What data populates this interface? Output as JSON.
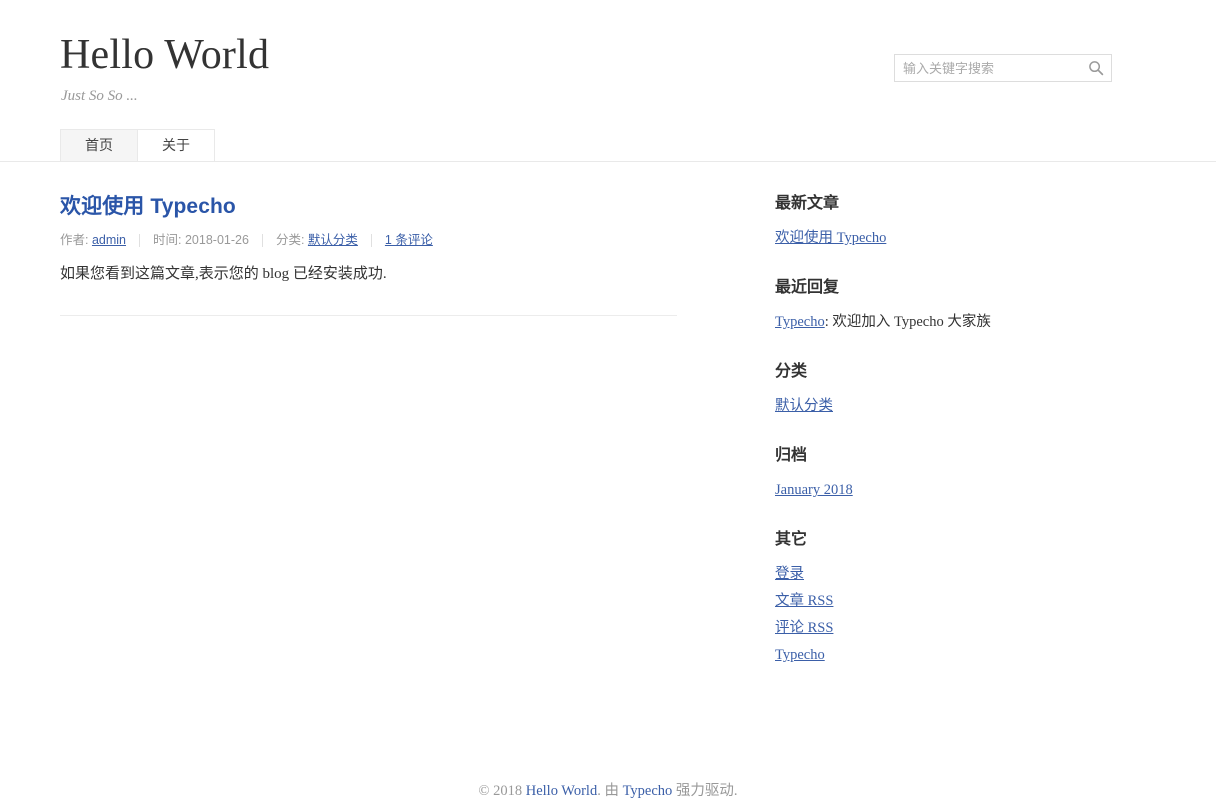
{
  "header": {
    "title": "Hello World",
    "description": "Just So So ...",
    "nav": [
      {
        "label": "首页",
        "active": true
      },
      {
        "label": "关于",
        "active": false
      }
    ],
    "search": {
      "placeholder": "输入关键字搜索",
      "value": "",
      "icon": "search-icon"
    }
  },
  "main": {
    "post": {
      "title": "欢迎使用 Typecho",
      "meta": {
        "author_label": "作者:",
        "author": "admin",
        "date_label": "时间:",
        "date": "2018-01-26",
        "category_label": "分类:",
        "category": "默认分类",
        "comments": "1 条评论"
      },
      "content": "如果您看到这篇文章,表示您的 blog 已经安装成功."
    }
  },
  "sidebar": {
    "recent_posts": {
      "title": "最新文章",
      "items": [
        {
          "label": "欢迎使用 Typecho"
        }
      ]
    },
    "recent_comments": {
      "title": "最近回复",
      "items": [
        {
          "author": "Typecho",
          "separator": ": ",
          "text": "欢迎加入 Typecho 大家族"
        }
      ]
    },
    "categories": {
      "title": "分类",
      "items": [
        {
          "label": "默认分类"
        }
      ]
    },
    "archives": {
      "title": "归档",
      "items": [
        {
          "label": "January 2018"
        }
      ]
    },
    "other": {
      "title": "其它",
      "items": [
        {
          "label": "登录"
        },
        {
          "label": "文章 RSS"
        },
        {
          "label": "评论 RSS"
        },
        {
          "label": "Typecho"
        }
      ]
    }
  },
  "footer": {
    "copyright": "© 2018",
    "site_link": "Hello World",
    "middle": ". 由",
    "engine_link": "Typecho",
    "suffix": "强力驱动."
  },
  "colors": {
    "link": "#3b5fa8",
    "title_link": "#2a55a8",
    "muted": "#999999",
    "text": "#333333",
    "border": "#e9e9e9",
    "tab_active_bg": "#f5f5f5"
  }
}
